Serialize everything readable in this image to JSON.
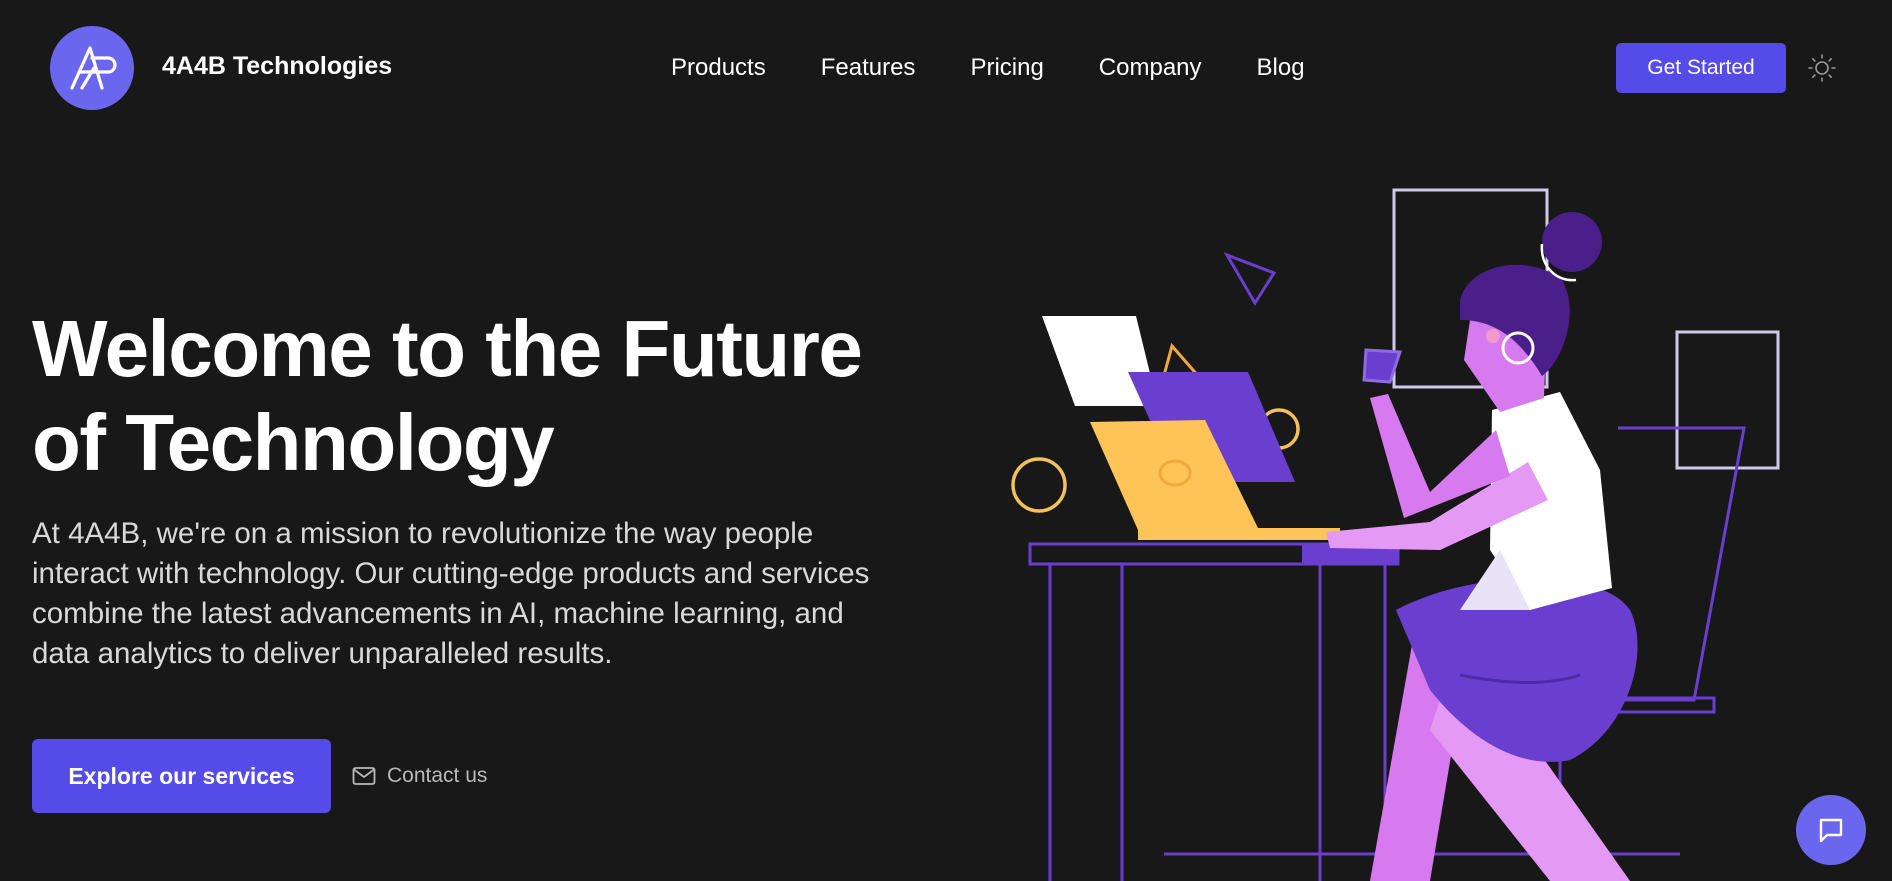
{
  "header": {
    "logo_icon": "a-monogram-logo",
    "brand_name": "4A4B Technologies",
    "nav": [
      {
        "label": "Products"
      },
      {
        "label": "Features"
      },
      {
        "label": "Pricing"
      },
      {
        "label": "Company"
      },
      {
        "label": "Blog"
      }
    ],
    "get_started_label": "Get Started",
    "theme_toggle_icon": "sun-icon"
  },
  "hero": {
    "title": "Welcome to the Future of Technology",
    "description": "At 4A4B, we're on a mission to revolutionize the way people interact with technology. Our cutting-edge products and services combine the latest advancements in AI, machine learning, and data analytics to deliver unparalleled results.",
    "primary_cta_label": "Explore our services",
    "contact_label": "Contact us",
    "contact_icon": "mail-icon",
    "illustration": "woman-working-at-laptop-illustration"
  },
  "chat": {
    "icon": "chat-icon"
  },
  "colors": {
    "background": "#181818",
    "accent": "#554be8",
    "logo_bg": "#6b66ee",
    "illustration_purple": "#6a3fd0",
    "illustration_pink": "#d77af0",
    "illustration_yellow": "#ffc457"
  }
}
